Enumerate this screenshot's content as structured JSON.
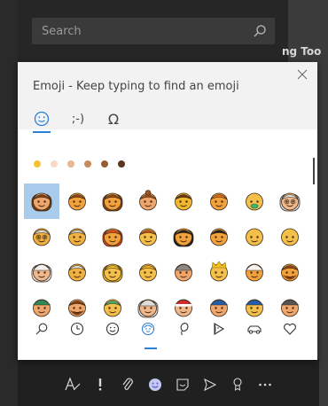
{
  "search": {
    "placeholder": "Search"
  },
  "background": {
    "partial_title": "ng Too",
    "partial_char": "?"
  },
  "emoji_panel": {
    "title": "Emoji - Keep typing to find an emoji",
    "tabs": [
      {
        "name": "emoji-tab",
        "icon": "smiley-icon",
        "active": true
      },
      {
        "name": "emoticon-tab",
        "label": ";-)"
      },
      {
        "name": "symbols-tab",
        "label": "Ω"
      }
    ],
    "skin_tones": [
      "#f4c430",
      "#f7d9c4",
      "#e8b894",
      "#c68a5e",
      "#9a5b34",
      "#5a3520"
    ],
    "emoji_grid": [
      [
        "woman",
        "boy",
        "girl",
        "person-red-hair",
        "man",
        "woman-orange",
        "baby-green-pacifier",
        "older-woman"
      ],
      [
        "older-man-glasses",
        "older-person",
        "woman-red-hair",
        "child",
        "man-dark-hair",
        "person-dark-hair",
        "face-yellow",
        "face-yellow-2"
      ],
      [
        "woman-headscarf",
        "man-turban-white",
        "blonde-person",
        "blonde-man",
        "person-with-turban",
        "prince-crown",
        "man-white-turban",
        "man-beard"
      ],
      [
        "elf",
        "man-brown-beard",
        "genie",
        "baby-bonnet",
        "santa",
        "police-officer",
        "police-officer-2",
        "detective"
      ]
    ],
    "categories": [
      {
        "name": "search-category",
        "icon": "search-icon"
      },
      {
        "name": "recent-category",
        "icon": "clock-icon"
      },
      {
        "name": "smiley-category",
        "icon": "smiley-icon"
      },
      {
        "name": "people-category",
        "icon": "person-face-icon",
        "active": true
      },
      {
        "name": "celebration-category",
        "icon": "balloon-icon"
      },
      {
        "name": "food-category",
        "icon": "pizza-icon"
      },
      {
        "name": "travel-category",
        "icon": "car-icon"
      },
      {
        "name": "symbols-category",
        "icon": "heart-icon"
      }
    ]
  },
  "chat_toolbar": {
    "items": [
      "format-icon",
      "important-icon",
      "attach-icon",
      "emoji-icon",
      "sticker-icon",
      "send-icon",
      "praise-icon",
      "more-icon"
    ]
  },
  "colors": {
    "accent": "#2c7fd6",
    "selection": "#a9ccec"
  }
}
